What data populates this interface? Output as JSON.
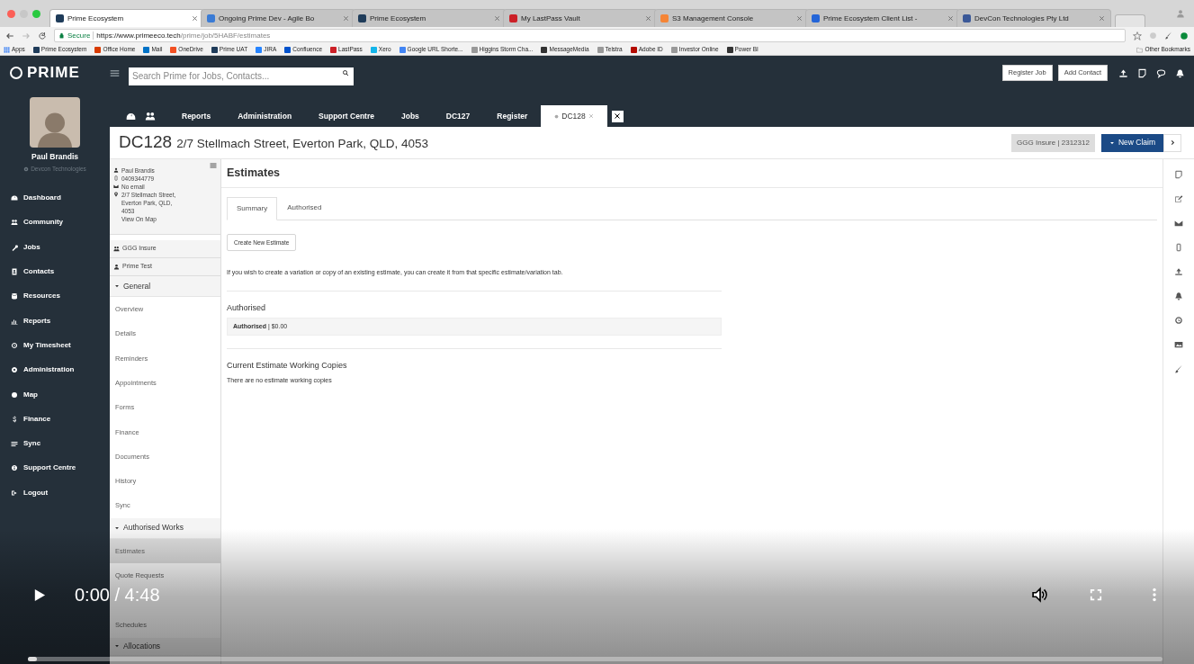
{
  "browser": {
    "tabs": [
      {
        "title": "Prime Ecosystem",
        "selected": true
      },
      {
        "title": "Ongoing Prime Dev - Agile Bo",
        "selected": false
      },
      {
        "title": "Prime Ecosystem",
        "selected": false
      },
      {
        "title": "My LastPass Vault",
        "selected": false
      },
      {
        "title": "S3 Management Console",
        "selected": false
      },
      {
        "title": "Prime Ecosystem Client List -",
        "selected": false
      },
      {
        "title": "DevCon Technologies Pty Ltd",
        "selected": false
      }
    ],
    "secure_label": "Secure",
    "url_host": "https://www.primeeco.tech",
    "url_path": "/prime/job/5HABF/estimates",
    "bookmarks": [
      "Apps",
      "Prime Ecosystem",
      "Office Home",
      "Mail",
      "OneDrive",
      "Prime UAT",
      "JIRA",
      "Confluence",
      "LastPass",
      "Xero",
      "Google URL Shorte...",
      "Higgins Storm Cha...",
      "MessageMedia",
      "Telstra",
      "Adobe ID",
      "Investor Online",
      "Power BI"
    ],
    "other_bookmarks": "Other Bookmarks"
  },
  "header": {
    "logo": "PRIME",
    "search": {
      "placeholder": "Search Prime for Jobs, Contacts..."
    },
    "buttons": [
      "Register Job",
      "Add Contact"
    ]
  },
  "user": {
    "name": "Paul Brandis",
    "company": "Devcon Technologies"
  },
  "sidebar": {
    "items": [
      "Dashboard",
      "Community",
      "Jobs",
      "Contacts",
      "Resources",
      "Reports",
      "My Timesheet",
      "Administration",
      "Map",
      "Finance",
      "Sync",
      "Support Centre",
      "Logout"
    ]
  },
  "nav_tabs": [
    {
      "label": "Reports",
      "selected": false
    },
    {
      "label": "Administration",
      "selected": false
    },
    {
      "label": "Support Centre",
      "selected": false
    },
    {
      "label": "Jobs",
      "selected": false
    },
    {
      "label": "DC127",
      "selected": false
    },
    {
      "label": "Register",
      "selected": false
    },
    {
      "label": "DC128",
      "selected": true
    }
  ],
  "job": {
    "id": "DC128",
    "address": "2/7 Stellmach Street, Everton Park, QLD, 4053",
    "insurer_badge": "GGG Insure | 2312312",
    "new_claim_button": "New Claim"
  },
  "contact": {
    "name": "Paul Brandis",
    "phone": "0409344779",
    "email": "No email",
    "address": "2/7 Stellmach Street, Everton Park, QLD, 4053",
    "map_link": "View On Map",
    "insurer": "GGG Insure",
    "contact_person": "Prime Test"
  },
  "job_menu": [
    {
      "section": "General",
      "expanded": true,
      "items": [
        {
          "label": "Overview",
          "selected": false
        },
        {
          "label": "Details",
          "selected": false
        },
        {
          "label": "Reminders",
          "selected": false
        },
        {
          "label": "Appointments",
          "selected": false
        },
        {
          "label": "Forms",
          "selected": false
        },
        {
          "label": "Finance",
          "selected": false
        },
        {
          "label": "Documents",
          "selected": false
        },
        {
          "label": "History",
          "selected": false
        },
        {
          "label": "Sync",
          "selected": false
        }
      ]
    },
    {
      "section": "Authorised Works",
      "expanded": true,
      "items": [
        {
          "label": "Estimates",
          "selected": true
        },
        {
          "label": "Quote Requests",
          "selected": false
        },
        {
          "label": "Schedules",
          "selected": false
        }
      ]
    },
    {
      "section": "Allocations",
      "expanded": true
    }
  ],
  "estimates": {
    "title": "Estimates",
    "tabs": [
      {
        "label": "Summary",
        "selected": true
      },
      {
        "label": "Authorised",
        "selected": false
      }
    ],
    "create_button": "Create New Estimate",
    "info": "If you wish to create a variation or copy of an existing estimate, you can create it from that specific estimate/variation tab.",
    "authorised_heading": "Authorised",
    "authorised_row": "**Authorised** | $0.00",
    "working_copies_heading": "Current Estimate Working Copies",
    "working_copies_empty": "There are no estimate working copies"
  },
  "video": {
    "time": "0:00 / 4:48",
    "progress": {
      "level": 0
    }
  }
}
